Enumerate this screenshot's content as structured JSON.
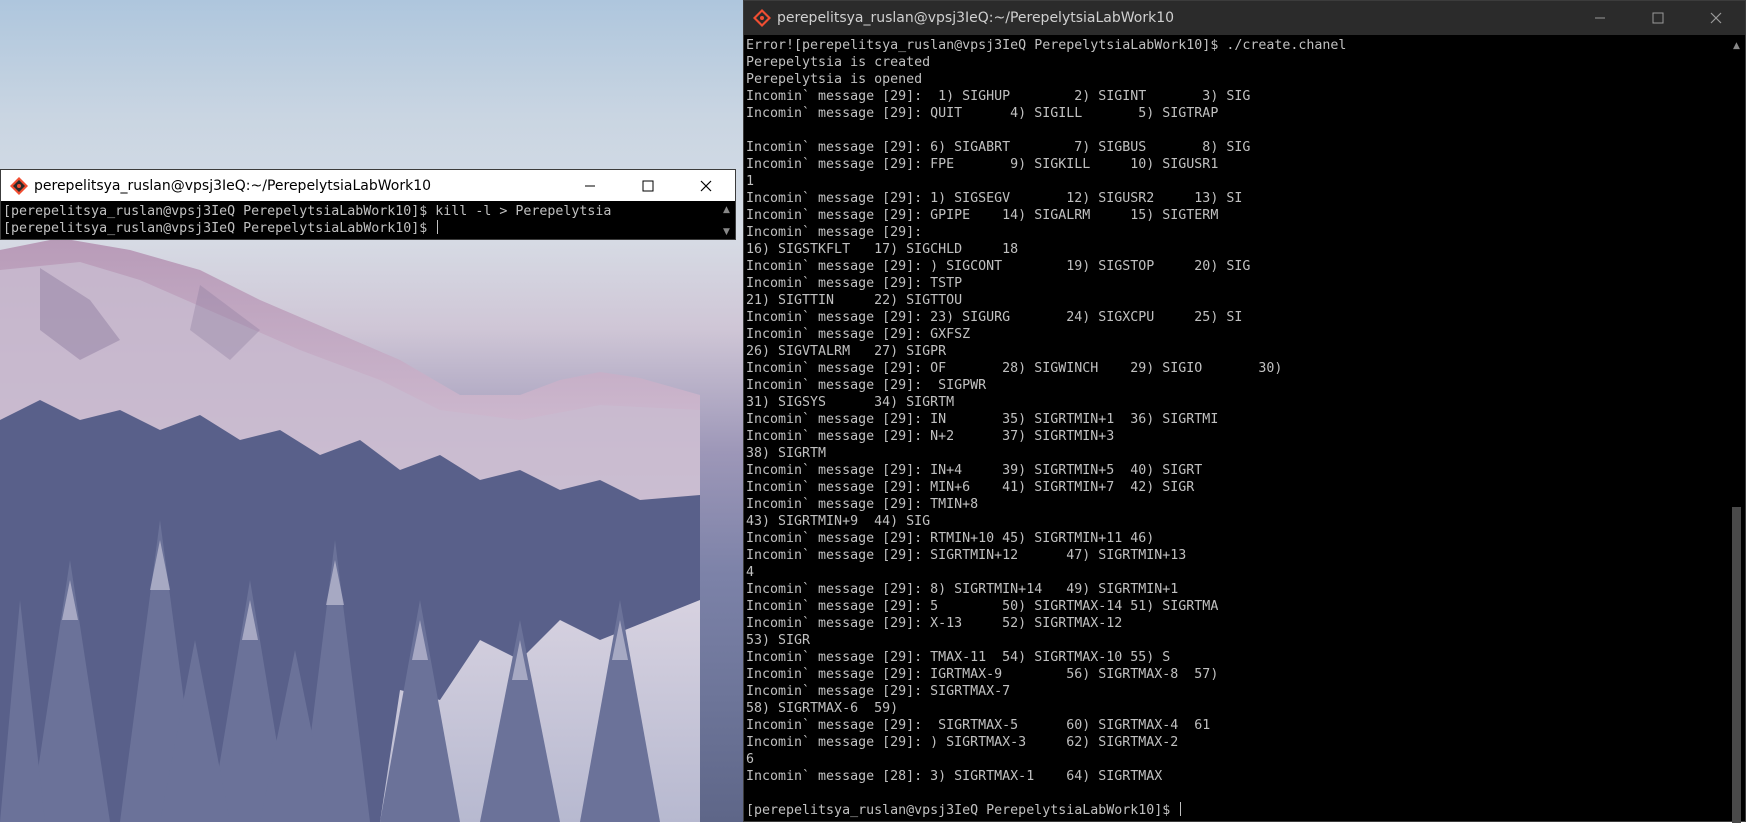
{
  "colors": {
    "terminal_bg": "#000000",
    "terminal_fg": "#c0c0c0",
    "left_titlebar_bg": "#ffffff",
    "right_titlebar_bg": "#2b2b2b"
  },
  "left_window": {
    "title": "perepelitsya_ruslan@vpsj3IeQ:~/PerepelytsiaLabWork10",
    "icon": "git-bash-icon",
    "lines": [
      "[perepelitsya_ruslan@vpsj3IeQ PerepelytsiaLabWork10]$ kill -l > Perepelytsia",
      "[perepelitsya_ruslan@vpsj3IeQ PerepelytsiaLabWork10]$ "
    ]
  },
  "right_window": {
    "title": "perepelitsya_ruslan@vpsj3IeQ:~/PerepelytsiaLabWork10",
    "icon": "git-bash-icon",
    "lines": [
      "Error![perepelitsya_ruslan@vpsj3IeQ PerepelytsiaLabWork10]$ ./create.chanel",
      "Perepelytsia is created",
      "Perepelytsia is opened",
      "Incomin` message [29]:  1) SIGHUP        2) SIGINT       3) SIG",
      "Incomin` message [29]: QUIT      4) SIGILL       5) SIGTRAP",
      "",
      "Incomin` message [29]: 6) SIGABRT        7) SIGBUS       8) SIG",
      "Incomin` message [29]: FPE       9) SIGKILL     10) SIGUSR1",
      "1",
      "Incomin` message [29]: 1) SIGSEGV       12) SIGUSR2     13) SI",
      "Incomin` message [29]: GPIPE    14) SIGALRM     15) SIGTERM",
      "Incomin` message [29]: ",
      "16) SIGSTKFLT   17) SIGCHLD     18",
      "Incomin` message [29]: ) SIGCONT        19) SIGSTOP     20) SIG",
      "Incomin` message [29]: TSTP",
      "21) SIGTTIN     22) SIGTTOU",
      "Incomin` message [29]: 23) SIGURG       24) SIGXCPU     25) SI",
      "Incomin` message [29]: GXFSZ",
      "26) SIGVTALRM   27) SIGPR",
      "Incomin` message [29]: OF       28) SIGWINCH    29) SIGIO       30)",
      "Incomin` message [29]:  SIGPWR",
      "31) SIGSYS      34) SIGRTM",
      "Incomin` message [29]: IN       35) SIGRTMIN+1  36) SIGRTMI",
      "Incomin` message [29]: N+2      37) SIGRTMIN+3",
      "38) SIGRTM",
      "Incomin` message [29]: IN+4     39) SIGRTMIN+5  40) SIGRT",
      "Incomin` message [29]: MIN+6    41) SIGRTMIN+7  42) SIGR",
      "Incomin` message [29]: TMIN+8",
      "43) SIGRTMIN+9  44) SIG",
      "Incomin` message [29]: RTMIN+10 45) SIGRTMIN+11 46)",
      "Incomin` message [29]: SIGRTMIN+12      47) SIGRTMIN+13",
      "4",
      "Incomin` message [29]: 8) SIGRTMIN+14   49) SIGRTMIN+1",
      "Incomin` message [29]: 5        50) SIGRTMAX-14 51) SIGRTMA",
      "Incomin` message [29]: X-13     52) SIGRTMAX-12",
      "53) SIGR",
      "Incomin` message [29]: TMAX-11  54) SIGRTMAX-10 55) S",
      "Incomin` message [29]: IGRTMAX-9        56) SIGRTMAX-8  57)",
      "Incomin` message [29]: SIGRTMAX-7",
      "58) SIGRTMAX-6  59)",
      "Incomin` message [29]:  SIGRTMAX-5      60) SIGRTMAX-4  61",
      "Incomin` message [29]: ) SIGRTMAX-3     62) SIGRTMAX-2",
      "6",
      "Incomin` message [28]: 3) SIGRTMAX-1    64) SIGRTMAX",
      "",
      "[perepelitsya_ruslan@vpsj3IeQ PerepelytsiaLabWork10]$ "
    ]
  }
}
